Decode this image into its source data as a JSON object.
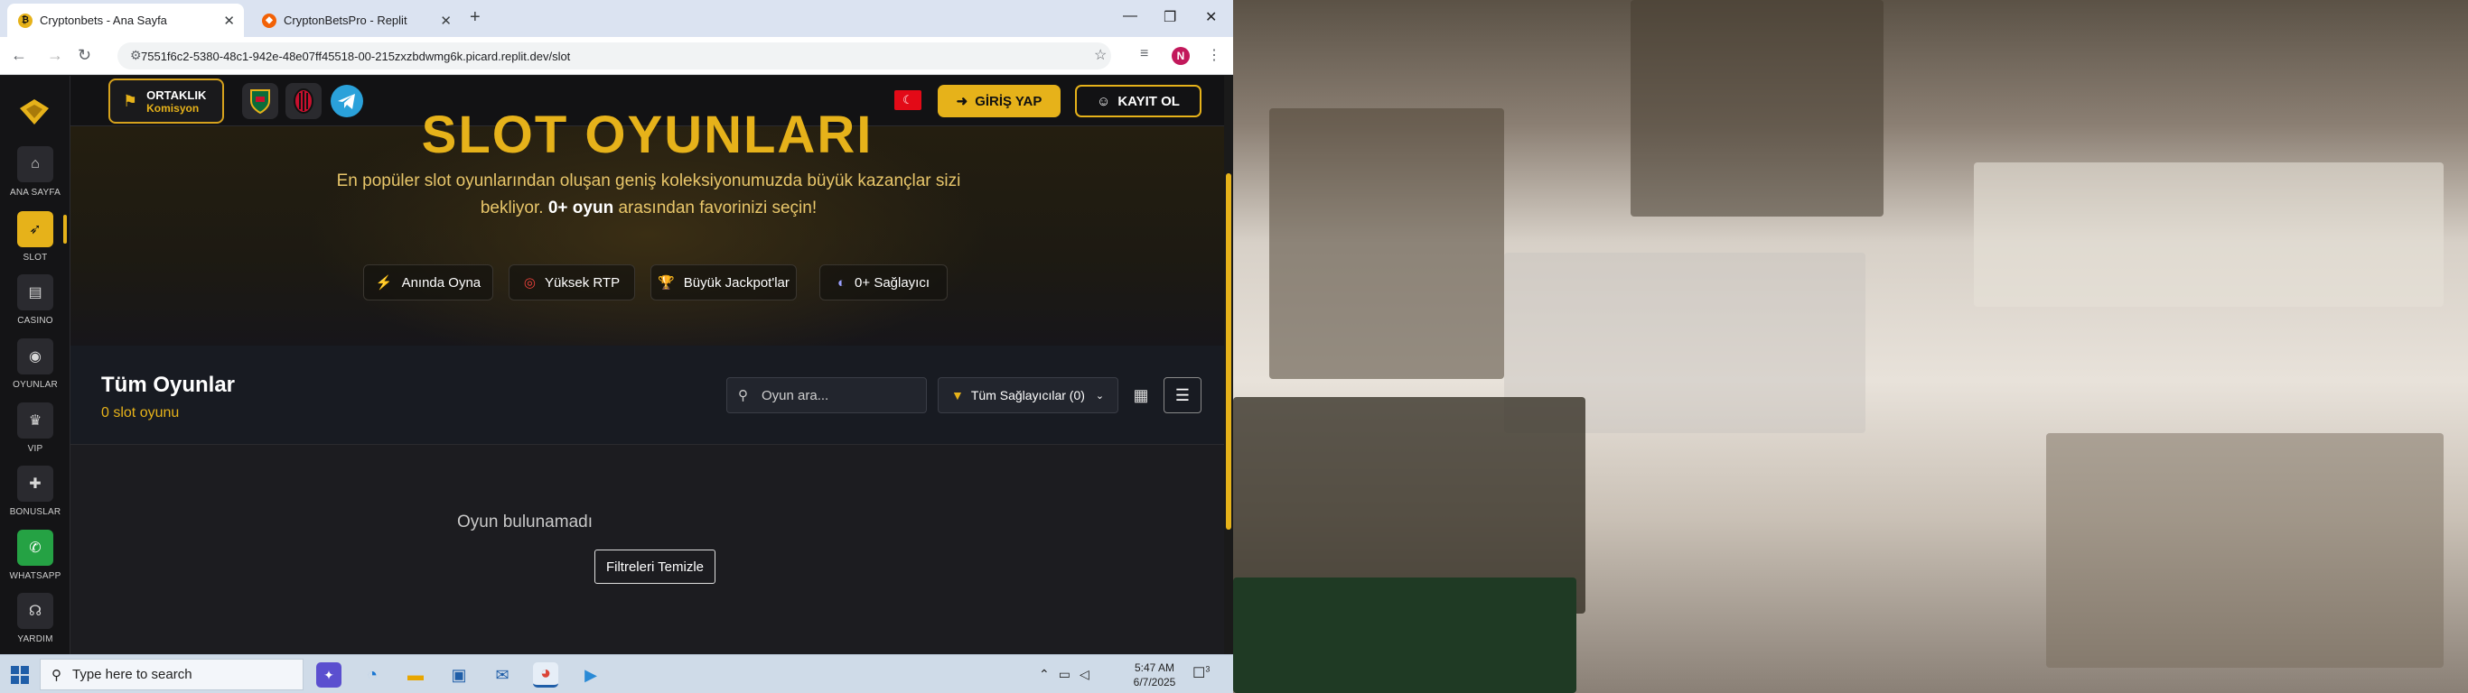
{
  "browser": {
    "tabs": [
      {
        "title": "Cryptonbets - Ana Sayfa",
        "active": true
      },
      {
        "title": "CryptonBetsPro - Replit",
        "active": false
      }
    ],
    "url": "7551f6c2-5380-48c1-942e-48e07ff45518-00-215zxzbdwmg6k.picard.replit.dev/slot",
    "profile_initial": "N"
  },
  "sidebar": {
    "items": [
      {
        "label": "ANA SAYFA",
        "icon": "home-icon"
      },
      {
        "label": "SLOT",
        "icon": "rocket-icon",
        "active": true
      },
      {
        "label": "CASINO",
        "icon": "cards-icon"
      },
      {
        "label": "OYUNLAR",
        "icon": "gamepad-icon"
      },
      {
        "label": "VIP",
        "icon": "crown-icon"
      },
      {
        "label": "BONUSLAR",
        "icon": "gift-icon"
      },
      {
        "label": "WHATSAPP",
        "icon": "whatsapp-icon"
      },
      {
        "label": "YARDIM",
        "icon": "headset-icon"
      }
    ]
  },
  "topbar": {
    "ortaklik_title": "ORTAKLIK",
    "ortaklik_sub": "Komisyon",
    "login_label": "GİRİŞ YAP",
    "register_label": "KAYIT OL"
  },
  "hero": {
    "title": "SLOT OYUNLARI",
    "desc_part1": "En popüler slot oyunlarından oluşan geniş koleksiyonumuzda büyük kazançlar sizi bekliyor.",
    "desc_bold": "0+ oyun",
    "desc_part2": "arasından favorinizi seçin!",
    "features": [
      "Anında Oyna",
      "Yüksek RTP",
      "Büyük Jackpot'lar",
      "0+ Sağlayıcı"
    ]
  },
  "games": {
    "title": "Tüm Oyunlar",
    "count_text": "0 slot oyunu",
    "search_placeholder": "Oyun ara...",
    "provider_filter": "Tüm Sağlayıcılar (0)",
    "empty_text": "Oyun bulunamadı",
    "clear_label": "Filtreleri Temizle"
  },
  "taskbar": {
    "search_placeholder": "Type here to search",
    "time": "5:47 AM",
    "date": "6/7/2025",
    "notification_count": "3"
  },
  "colors": {
    "accent": "#e6b21a",
    "page_bg": "#1c1c1f",
    "whatsapp": "#25a244"
  }
}
